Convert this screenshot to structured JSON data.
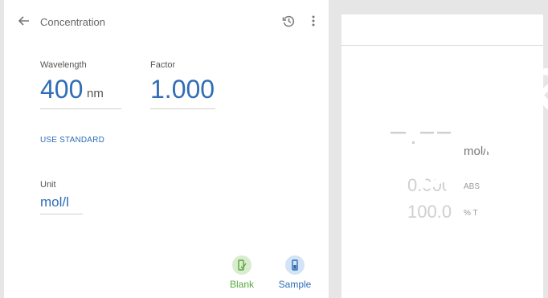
{
  "header": {
    "title": "Concentration",
    "back_icon": "arrow-left-icon",
    "history_icon": "history-icon",
    "more_icon": "more-vert-icon"
  },
  "wavelength": {
    "label": "Wavelength",
    "value": "400",
    "unit": "nm"
  },
  "factor": {
    "label": "Factor",
    "value": "1.000"
  },
  "use_standard": "USE STANDARD",
  "unit_field": {
    "label": "Unit",
    "value": "mol/l"
  },
  "actions": {
    "blank": {
      "label": "Blank",
      "icon": "blank-cuvette-icon",
      "color": "#5aa83c"
    },
    "sample": {
      "label": "Sample",
      "icon": "sample-cuvette-icon",
      "color": "#2f6db5"
    }
  },
  "readout": {
    "value_placeholder": "-.--",
    "unit": "mol/l",
    "abs_value": "0.000",
    "abs_unit": "ABS",
    "t_value": "100.0",
    "t_unit": "% T"
  },
  "watermark": "SCHER",
  "colors": {
    "accent": "#2f6db5",
    "blank_green": "#5aa83c",
    "background": "#e6e6e6"
  }
}
